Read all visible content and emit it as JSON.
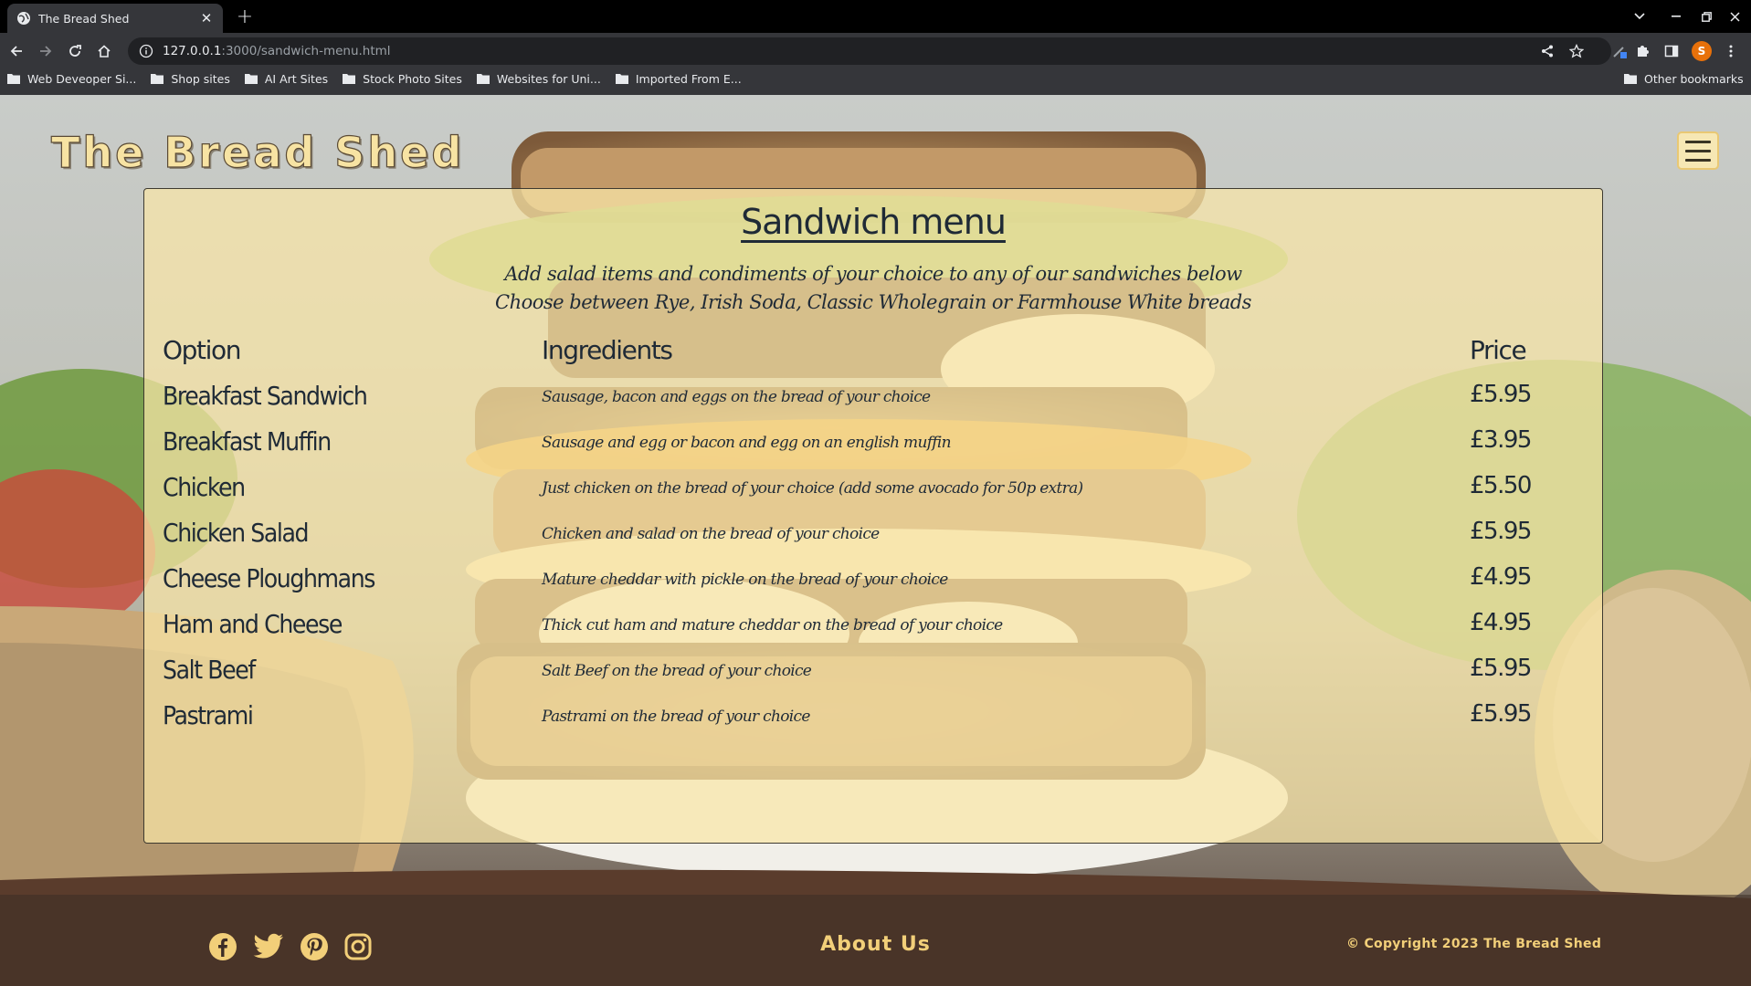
{
  "browser": {
    "tab_title": "The Bread Shed",
    "url_host": "127.0.0.1",
    "url_path": ":3000/sandwich-menu.html",
    "profile_initial": "S",
    "bookmarks": [
      "Web Deveoper Si...",
      "Shop sites",
      "AI Art Sites",
      "Stock Photo Sites",
      "Websites for Uni...",
      "Imported From E..."
    ],
    "other_bookmarks": "Other bookmarks"
  },
  "site": {
    "logo": "The Bread Shed"
  },
  "menu": {
    "title": "Sandwich menu",
    "subtitle_line1": "Add salad items and condiments of your choice to any of our sandwiches below",
    "subtitle_line2": "Choose between Rye, Irish Soda, Classic Wholegrain or Farmhouse White breads",
    "headers": {
      "option": "Option",
      "ingredients": "Ingredients",
      "price": "Price"
    },
    "items": [
      {
        "option": "Breakfast Sandwich",
        "ingredients": "Sausage, bacon and eggs on the bread of your choice",
        "price": "£5.95"
      },
      {
        "option": "Breakfast Muffin",
        "ingredients": "Sausage and egg or bacon and egg on an english muffin",
        "price": "£3.95"
      },
      {
        "option": "Chicken",
        "ingredients": "Just chicken on the bread of your choice (add some avocado for 50p extra)",
        "price": "£5.50"
      },
      {
        "option": "Chicken Salad",
        "ingredients": "Chicken and salad on the bread of your choice",
        "price": "£5.95"
      },
      {
        "option": "Cheese Ploughmans",
        "ingredients": "Mature cheddar with pickle on the bread of your choice",
        "price": "£4.95"
      },
      {
        "option": "Ham and Cheese",
        "ingredients": "Thick cut ham and mature cheddar on the bread of your choice",
        "price": "£4.95"
      },
      {
        "option": "Salt Beef",
        "ingredients": "Salt Beef on the bread of your choice",
        "price": "£5.95"
      },
      {
        "option": "Pastrami",
        "ingredients": "Pastrami on the bread of your choice",
        "price": "£5.95"
      }
    ]
  },
  "footer": {
    "social_icons": [
      "facebook-icon",
      "twitter-icon",
      "pinterest-icon",
      "instagram-icon"
    ],
    "about": "About Us",
    "copyright": "© Copyright 2023 The Bread Shed"
  },
  "colors": {
    "logo": "#f7e3a3",
    "card": "#fae6a8",
    "text": "#1f2a36",
    "footer_text": "#f2cf79"
  }
}
